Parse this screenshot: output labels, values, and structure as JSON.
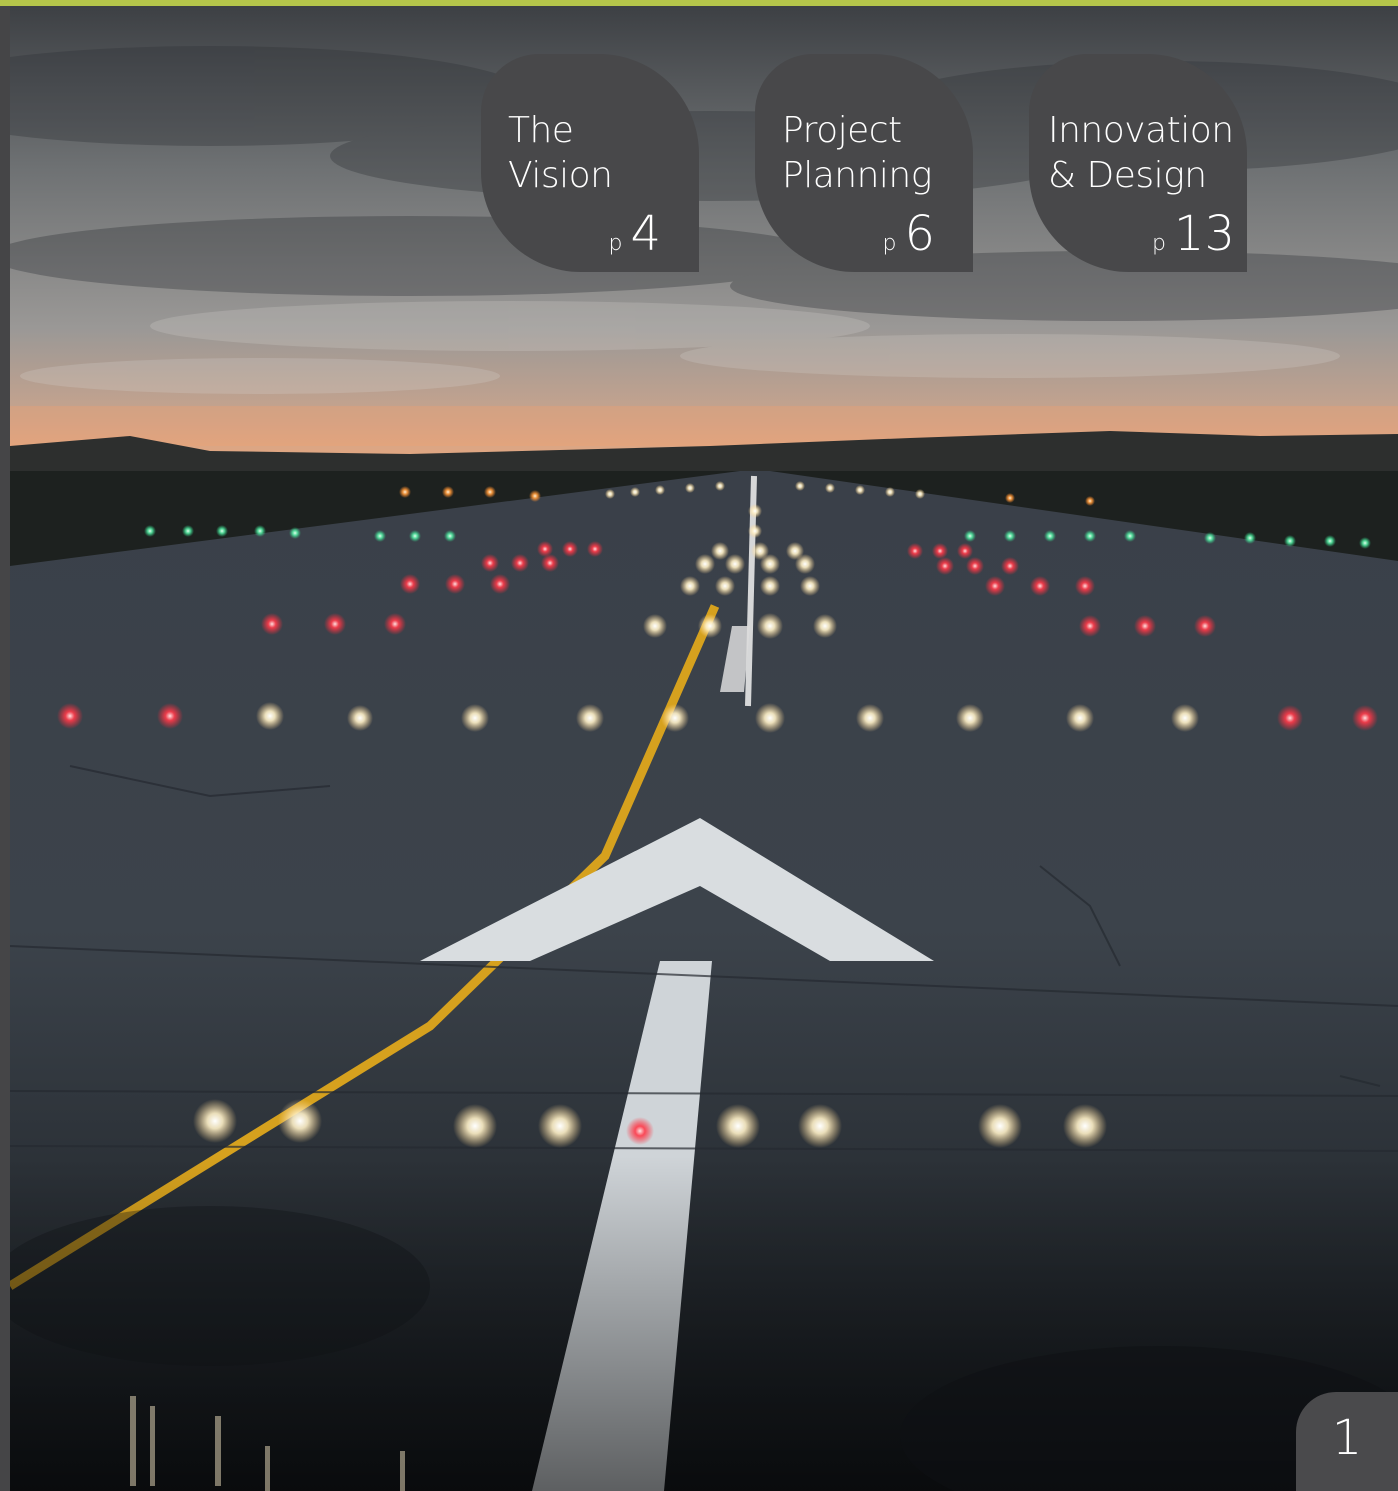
{
  "toc": [
    {
      "title": "The\nVision",
      "page_prefix": "p",
      "page": "4"
    },
    {
      "title": "Project\nPlanning",
      "page_prefix": "p",
      "page": "6"
    },
    {
      "title": "Innovation\n& Design",
      "page_prefix": "p",
      "page": "13"
    }
  ],
  "page_number": "1",
  "colors": {
    "accent": "#b5c54a",
    "tab_bg": "#48484a",
    "text": "#ffffff"
  },
  "image": {
    "subject": "runway-lights-dusk"
  }
}
